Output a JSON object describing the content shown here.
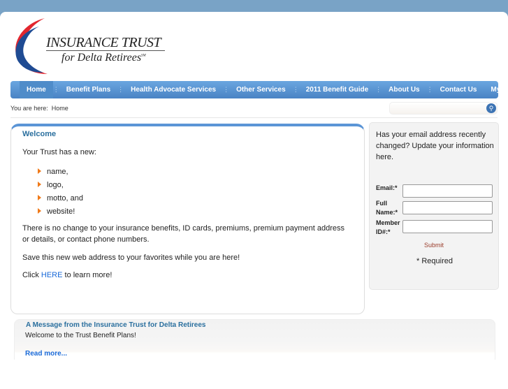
{
  "logo": {
    "line1": "INSURANCE TRUST",
    "line2": "for Delta Retirees",
    "mark": "SM"
  },
  "nav": {
    "items": [
      "Home",
      "Benefit Plans",
      "Health Advocate Services",
      "Other Services",
      "2011 Benefit Guide",
      "About Us",
      "Contact Us",
      "My Account"
    ],
    "active": "Home"
  },
  "breadcrumb": {
    "label": "You are here:",
    "current": "Home"
  },
  "search": {
    "placeholder": "",
    "icon": "search-icon"
  },
  "welcome": {
    "title": "Welcome",
    "intro": "Your Trust has a new:",
    "bullets": [
      "name,",
      "logo,",
      "motto, and",
      "website!"
    ],
    "para1": "There is no change to your insurance benefits, ID cards, premiums, premium payment address or details, or contact phone numbers.",
    "para2": "Save this new web address to your favorites while you are here!",
    "click_pre": "Click ",
    "click_link": "HERE",
    "click_post": " to learn more!"
  },
  "sidebar": {
    "text": "Has your email address recently changed? Update your information here.",
    "email_label": "Email:*",
    "name_label": "Full Name:*",
    "member_label": "Member ID#:*",
    "email_value": "",
    "name_value": "",
    "member_value": "",
    "submit": "Submit",
    "required": "* Required"
  },
  "message": {
    "title": "A Message from the Insurance Trust for Delta Retirees",
    "text": "Welcome to the Trust Benefit Plans!",
    "read_more": "Read more..."
  },
  "colors": {
    "nav": "#5a93d2",
    "accent_title": "#2a6f9e",
    "link": "#1a6ad8",
    "bullet": "#f07a1a",
    "top_bar": "#79a3c6"
  }
}
